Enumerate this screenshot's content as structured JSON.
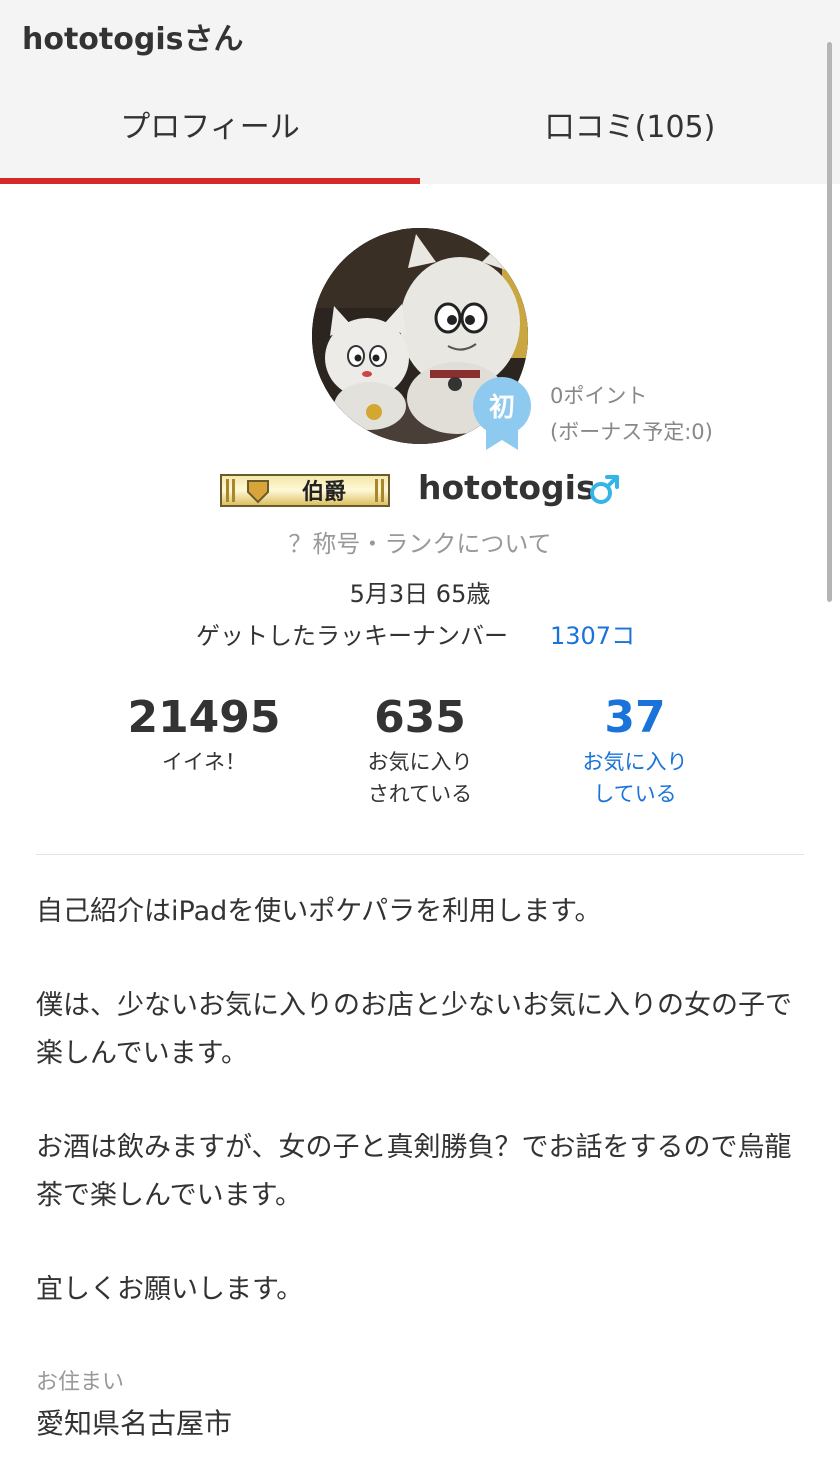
{
  "header": {
    "title": "hototogisさん",
    "tabs": [
      {
        "label": "プロフィール",
        "active": true
      },
      {
        "label": "口コミ(105)",
        "active": false
      }
    ],
    "active_color": "#d62a2a"
  },
  "profile": {
    "avatar_icon": "plush-toys-photo",
    "beginner_badge": "初",
    "points": "0ポイント",
    "bonus": "(ボーナス予定:0)",
    "title_badge": "伯爵",
    "username": "hototogis",
    "gender_symbol": "♂",
    "rank_link": "？称号・ランクについて",
    "birthday": "5月3日 65歳",
    "lucky_label": "ゲットしたラッキーナンバー",
    "lucky_value": "1307コ",
    "link_color": "#1a73d9"
  },
  "stats": [
    {
      "value": "21495",
      "label_line1": "イイネ！",
      "label_line2": ""
    },
    {
      "value": "635",
      "label_line1": "お気に入り",
      "label_line2": "されている"
    },
    {
      "value": "37",
      "label_line1": "お気に入り",
      "label_line2": "している"
    }
  ],
  "intro": {
    "paragraphs": [
      "自己紹介はiPadを使いポケパラを利用します。",
      "僕は、少ないお気に入りのお店と少ないお気に入りの女の子で楽しんでいます。",
      "お酒は飲みますが、女の子と真剣勝負？でお話をするので烏龍茶で楽しんでいます。",
      "宜しくお願いします。"
    ]
  },
  "residence": {
    "label": "お住まい",
    "value": "愛知県名古屋市"
  }
}
